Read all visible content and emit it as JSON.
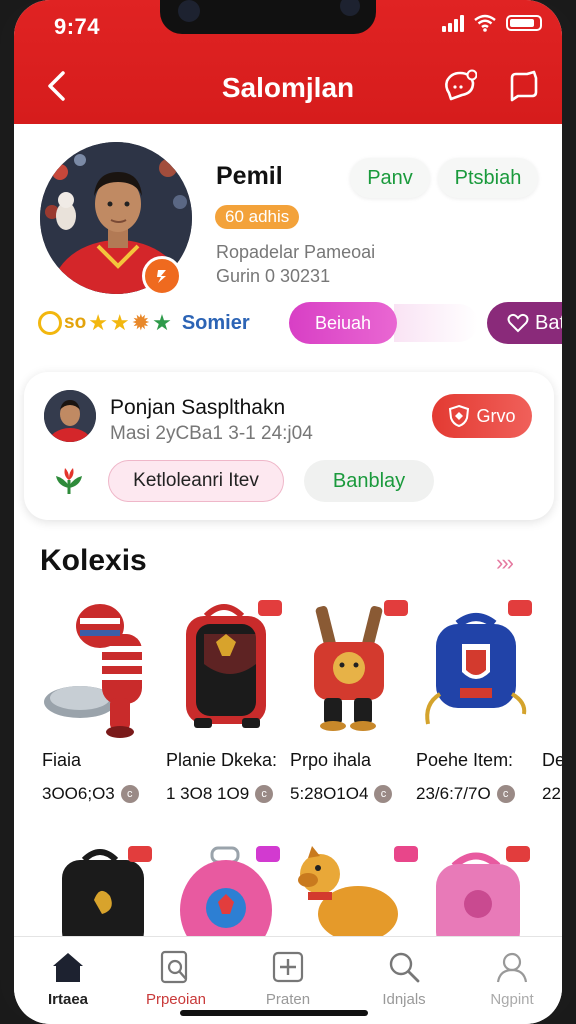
{
  "status": {
    "time": "9:74"
  },
  "header": {
    "title": "Salomjlan"
  },
  "profile": {
    "name": "Pemil",
    "level": "60 adhis",
    "meta_line1": "Ropadelar Pameoai",
    "meta_line2": "Gurin 0 30231",
    "follow_label": "Panv",
    "message_label": "Ptsbiah",
    "rank_prefix": "so",
    "rank_label": "Somier",
    "pink_btn_label": "Beiuah",
    "purple_btn_label": "Bat"
  },
  "card": {
    "name": "Ponjan Sasplthakn",
    "meta": "Masi 2yCBa1 3-1 24:j04",
    "action_label": "Grvo",
    "pill1_label": "Ketloleanri Itev",
    "pill2_label": "Banblay"
  },
  "section": {
    "title": "Kolexis",
    "more": "›››"
  },
  "items": [
    {
      "name": "Fiaia",
      "price": "3OO6;O3"
    },
    {
      "name": "Planie Dkeka:",
      "price": "1 3O8 1O9"
    },
    {
      "name": "Prpo ihala",
      "price": "5:28O1O4"
    },
    {
      "name": "Poehe Item:",
      "price": "23/6:7/7O"
    },
    {
      "name": "De",
      "price": "22"
    }
  ],
  "tabs": [
    {
      "label": "Irtaea"
    },
    {
      "label": "Prpeoian"
    },
    {
      "label": "Praten"
    },
    {
      "label": "Idnjals"
    },
    {
      "label": "Ngpint"
    }
  ],
  "colors": {
    "primary": "#d91f1f",
    "accent_green": "#1a9a3c",
    "accent_pink": "#d83fc5"
  }
}
